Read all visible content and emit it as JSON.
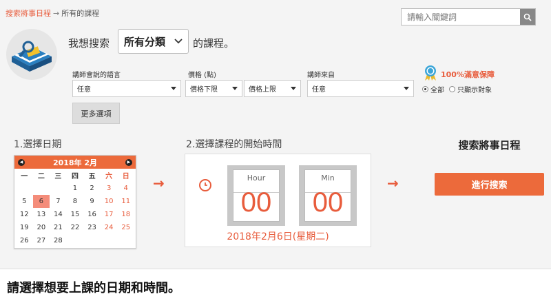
{
  "breadcrumb": {
    "link": "搜索將事日程",
    "sep": "→",
    "current": "所有的課程"
  },
  "search": {
    "placeholder": "請輸入關鍵詞"
  },
  "query": {
    "prefix": "我想搜索",
    "category": "所有分類",
    "suffix": "的課程。"
  },
  "filters": {
    "language_label": "講師會說的語言",
    "language_value": "任意",
    "price_label": "價格 (點)",
    "price_min": "價格下限",
    "price_max": "價格上限",
    "from_label": "講師來自",
    "from_value": "任意",
    "more_label": "更多選項"
  },
  "guarantee": {
    "title": "100%滿意保障",
    "opt_all": "全部",
    "opt_only": "只顯示對象"
  },
  "step1": {
    "label": "1.選擇日期"
  },
  "calendar": {
    "month": "2018年 2月",
    "weekdays": [
      "一",
      "二",
      "三",
      "四",
      "五",
      "六",
      "日"
    ],
    "days": [
      "",
      "",
      "",
      "1",
      "2",
      "3",
      "4",
      "5",
      "6",
      "7",
      "8",
      "9",
      "10",
      "11",
      "12",
      "13",
      "14",
      "15",
      "16",
      "17",
      "18",
      "19",
      "20",
      "21",
      "22",
      "23",
      "24",
      "25",
      "26",
      "27",
      "28",
      "",
      "",
      "",
      ""
    ],
    "selected": "6"
  },
  "step2": {
    "label": "2.選擇課程的開始時間",
    "hour_label": "Hour",
    "hour_value": "00",
    "min_label": "Min",
    "min_value": "00",
    "date_text": "2018年2月6日(星期二)"
  },
  "action": {
    "title": "搜索將事日程",
    "button": "進行搜索"
  },
  "footer": {
    "instruction": "請選擇想要上課的日期和時間。"
  },
  "colors": {
    "accent": "#ec6a3b",
    "selected_day": "#f48c7a"
  }
}
